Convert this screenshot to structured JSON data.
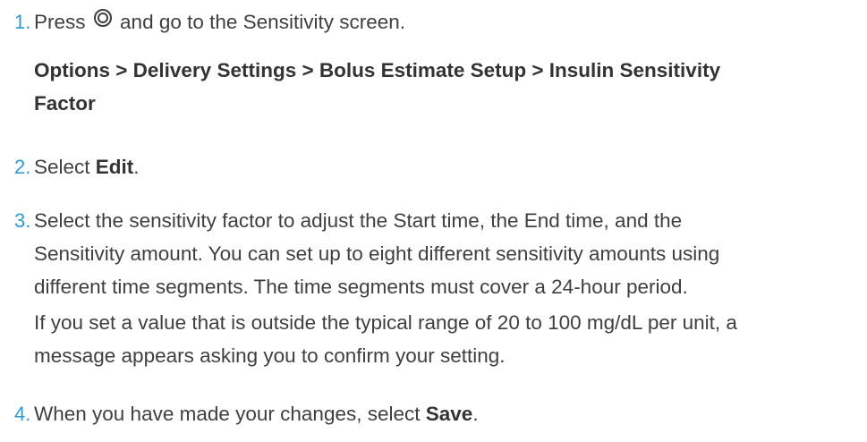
{
  "steps": [
    {
      "number": "1.",
      "pre": "Press",
      "icon": "options-button-icon",
      "post": "and go to the Sensitivity screen.",
      "menu_path": [
        "Options > Delivery Settings > Bolus Estimate Setup > Insulin Sensitivity",
        "Factor"
      ]
    },
    {
      "number": "2.",
      "pre": "Select ",
      "bold": "Edit",
      "post": "."
    },
    {
      "number": "3.",
      "lines": [
        "Select the sensitivity factor to adjust the Start time, the End time, and the",
        "Sensitivity amount. You can set up to eight different sensitivity amounts using",
        "different time segments. The time segments must cover a 24-hour period."
      ],
      "note_lines": [
        "If you set a value that is outside the typical range of 20 to 100 mg/dL per unit, a",
        "message appears asking you to confirm your setting."
      ]
    },
    {
      "number": "4.",
      "pre": "When you have made your changes, select ",
      "bold": "Save",
      "post": "."
    }
  ],
  "colors": {
    "step_number": "#2e9bd6",
    "body_text": "#3f3f3f",
    "bold_text": "#333333"
  }
}
